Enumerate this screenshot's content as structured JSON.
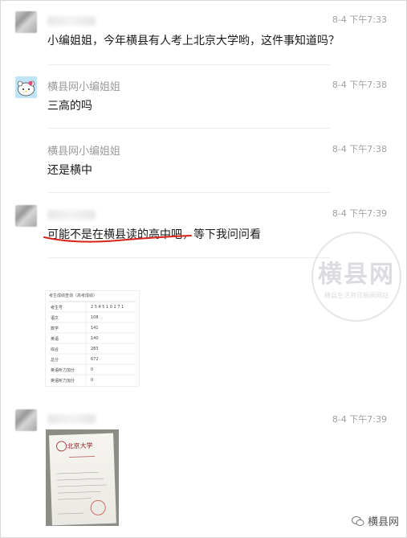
{
  "messages": [
    {
      "time": "8-4 下午7:33",
      "text": "小编姐姐，今年横县有人考上北京大学哟，这件事知道吗？"
    },
    {
      "sender": "横县网小编姐姐",
      "time": "8-4 下午7:38",
      "text": "三高的吗"
    },
    {
      "sender": "横县网小编姐姐",
      "time": "8-4 下午7:38",
      "text": "还是横中"
    },
    {
      "time": "8-4 下午7:39",
      "text_parts": [
        "可能不是在横县读的高中吧",
        "，等下我问问看"
      ]
    },
    {
      "time": "8-4 下午7:39"
    }
  ],
  "score_table": {
    "title": "考生成绩查询（高考成绩）",
    "rows": [
      {
        "label": "考生号",
        "value": "2 5 4 5 1 0 2 7 1"
      },
      {
        "label": "语文",
        "value": "108"
      },
      {
        "label": "数学",
        "value": "141"
      },
      {
        "label": "英语",
        "value": "140"
      },
      {
        "label": "综合",
        "value": "283"
      },
      {
        "label": "总分",
        "value": "672"
      },
      {
        "label": "英语听力加分",
        "value": "0"
      },
      {
        "label": "英语听力加分",
        "value": "0"
      }
    ]
  },
  "letter_title": "北京大学",
  "watermark": {
    "main": "横县网",
    "sub": "横县生活资讯新闻网站"
  },
  "footer": {
    "brand": "横县网"
  }
}
